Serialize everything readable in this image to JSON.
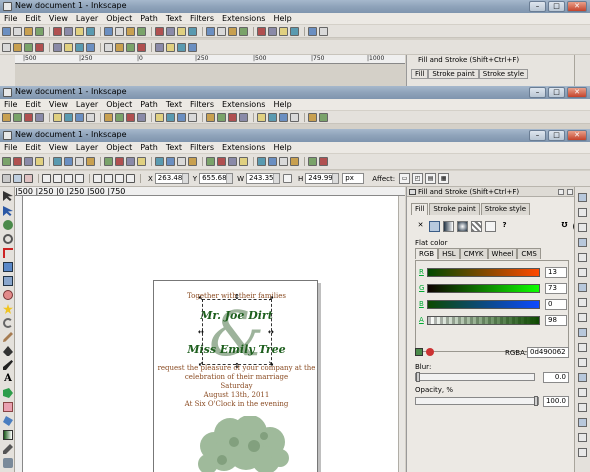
{
  "window": {
    "title": "New document 1 - Inkscape",
    "buttons": {
      "minimize": "–",
      "maximize": "□",
      "close": "✕"
    }
  },
  "menu": [
    "File",
    "Edit",
    "View",
    "Layer",
    "Object",
    "Path",
    "Text",
    "Filters",
    "Extensions",
    "Help"
  ],
  "ruler_ticks": [
    "|500",
    "|250",
    "|0",
    "|250",
    "|500",
    "|750",
    "|1000"
  ],
  "ghost_panel": {
    "title": "Fill and Stroke (Shift+Ctrl+F)",
    "tabs": [
      "Fill",
      "Stroke paint",
      "Stroke style"
    ]
  },
  "controls": {
    "x_label": "X",
    "x_value": "263.485",
    "y_label": "Y",
    "y_value": "655.687",
    "w_label": "W",
    "w_value": "243.353",
    "h_label": "H",
    "h_value": "249.990",
    "unit": "px",
    "affect_label": "Affect:"
  },
  "canvas": {
    "lines": {
      "line1": "Together with their families",
      "line2": "Mr. Joe Dirt",
      "line3": "Miss Emily Tree",
      "line4": "request the pleasure of your company at the",
      "line5": "celebration of their marriage",
      "line6": "Saturday",
      "line7": "August 13th, 2011",
      "line8": "At Six O'Clock in the evening"
    },
    "ampersand": "&"
  },
  "fill_stroke": {
    "title": "Fill and Stroke (Shift+Ctrl+F)",
    "tabs": [
      "Fill",
      "Stroke paint",
      "Stroke style"
    ],
    "paint_none": "✕",
    "paint_unset": "?",
    "flat_color_label": "Flat color",
    "modes": [
      "RGB",
      "HSL",
      "CMYK",
      "Wheel",
      "CMS"
    ],
    "channels": [
      {
        "label": "R",
        "value": "13"
      },
      {
        "label": "G",
        "value": "73"
      },
      {
        "label": "B",
        "value": "0"
      },
      {
        "label": "A",
        "value": "98"
      }
    ],
    "rgba_label": "RGBA:",
    "rgba_value": "0d490062",
    "blur_label": "Blur:",
    "blur_value": "0.0",
    "opacity_label": "Opacity, %",
    "opacity_value": "100.0",
    "opacity_level": 1.0,
    "blur_level": 0.0
  },
  "colors": {
    "selected_fill": "#0d4900",
    "text_brown": "#8a4b22",
    "text_green": "#1d5e1d",
    "titlebar": "#8fa3ba"
  }
}
